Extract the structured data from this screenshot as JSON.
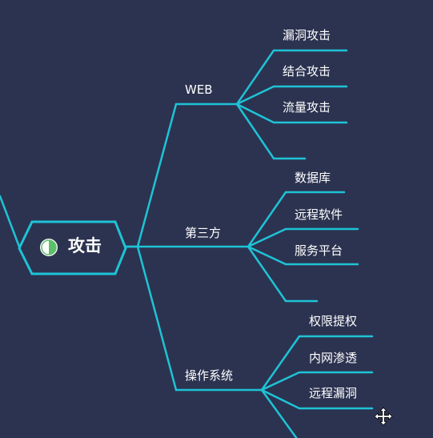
{
  "mindmap": {
    "root": {
      "label": "攻击",
      "icon": "half-circle-icon"
    },
    "branches": [
      {
        "label": "WEB",
        "children": [
          "漏洞攻击",
          "结合攻击",
          "流量攻击",
          ""
        ]
      },
      {
        "label": "第三方",
        "children": [
          "数据库",
          "远程软件",
          "服务平台",
          ""
        ]
      },
      {
        "label": "操作系统",
        "children": [
          "权限提权",
          "内网渗透",
          "远程漏洞",
          ""
        ]
      }
    ]
  },
  "colors": {
    "background": "#2c3350",
    "line": "#1ec3d6",
    "text": "#ffffff",
    "icon_green": "#5cbf6a"
  },
  "cursor": {
    "icon": "move-cursor-icon"
  }
}
